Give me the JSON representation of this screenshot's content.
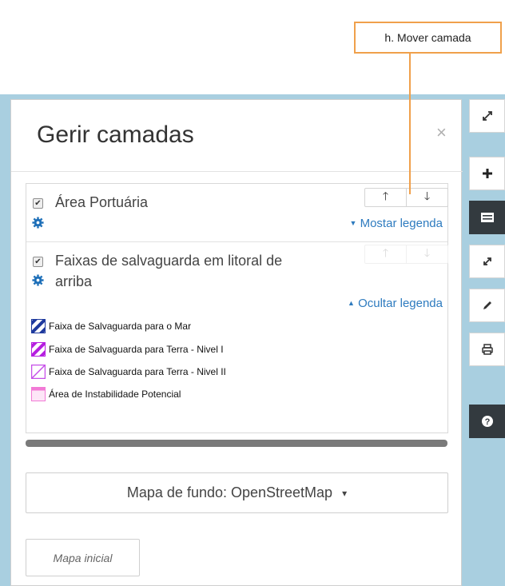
{
  "callout": {
    "label": "h. Mover camada",
    "color": "#f0a04b"
  },
  "panel": {
    "title": "Gerir camadas",
    "close_label": "×"
  },
  "layers": [
    {
      "name": "Área Portuária",
      "checked": true,
      "legend_toggle": "Mostar legenda",
      "legend_toggle_icon": "caret-down-icon"
    },
    {
      "name_line1": "Faixas de salvaguarda em litoral de",
      "name_line2": "arriba",
      "checked": true,
      "legend_toggle": "Ocultar legenda",
      "legend_toggle_icon": "caret-up-icon",
      "legend": [
        {
          "label": "Faixa de Salvaguarda para o Mar",
          "color": "#1f3a9e"
        },
        {
          "label": "Faixa de Salvaguarda para Terra - Nivel I",
          "color": "#b51fe0"
        },
        {
          "label": "Faixa de Salvaguarda para Terra - Nivel II",
          "color": "#c64fe8"
        },
        {
          "label": "Área de Instabilidade Potencial",
          "color": "#f27ad6"
        }
      ]
    }
  ],
  "arrows": {
    "up": "🡑",
    "down": "🡓"
  },
  "basemap": {
    "label": "Mapa de fundo: OpenStreetMap",
    "caret": "▾"
  },
  "initial_map": {
    "label": "Mapa inicial"
  },
  "toolbar": [
    {
      "icon": "expand-icon"
    },
    {
      "icon": "plus-icon"
    },
    {
      "icon": "layers-icon"
    },
    {
      "icon": "fullscreen-icon"
    },
    {
      "icon": "pencil-icon"
    },
    {
      "icon": "print-icon"
    },
    {
      "icon": "help-icon"
    }
  ],
  "colors": {
    "accent": "#2e7bbf",
    "map_water": "#a9cfe0",
    "dark_tool": "#333a3f"
  }
}
